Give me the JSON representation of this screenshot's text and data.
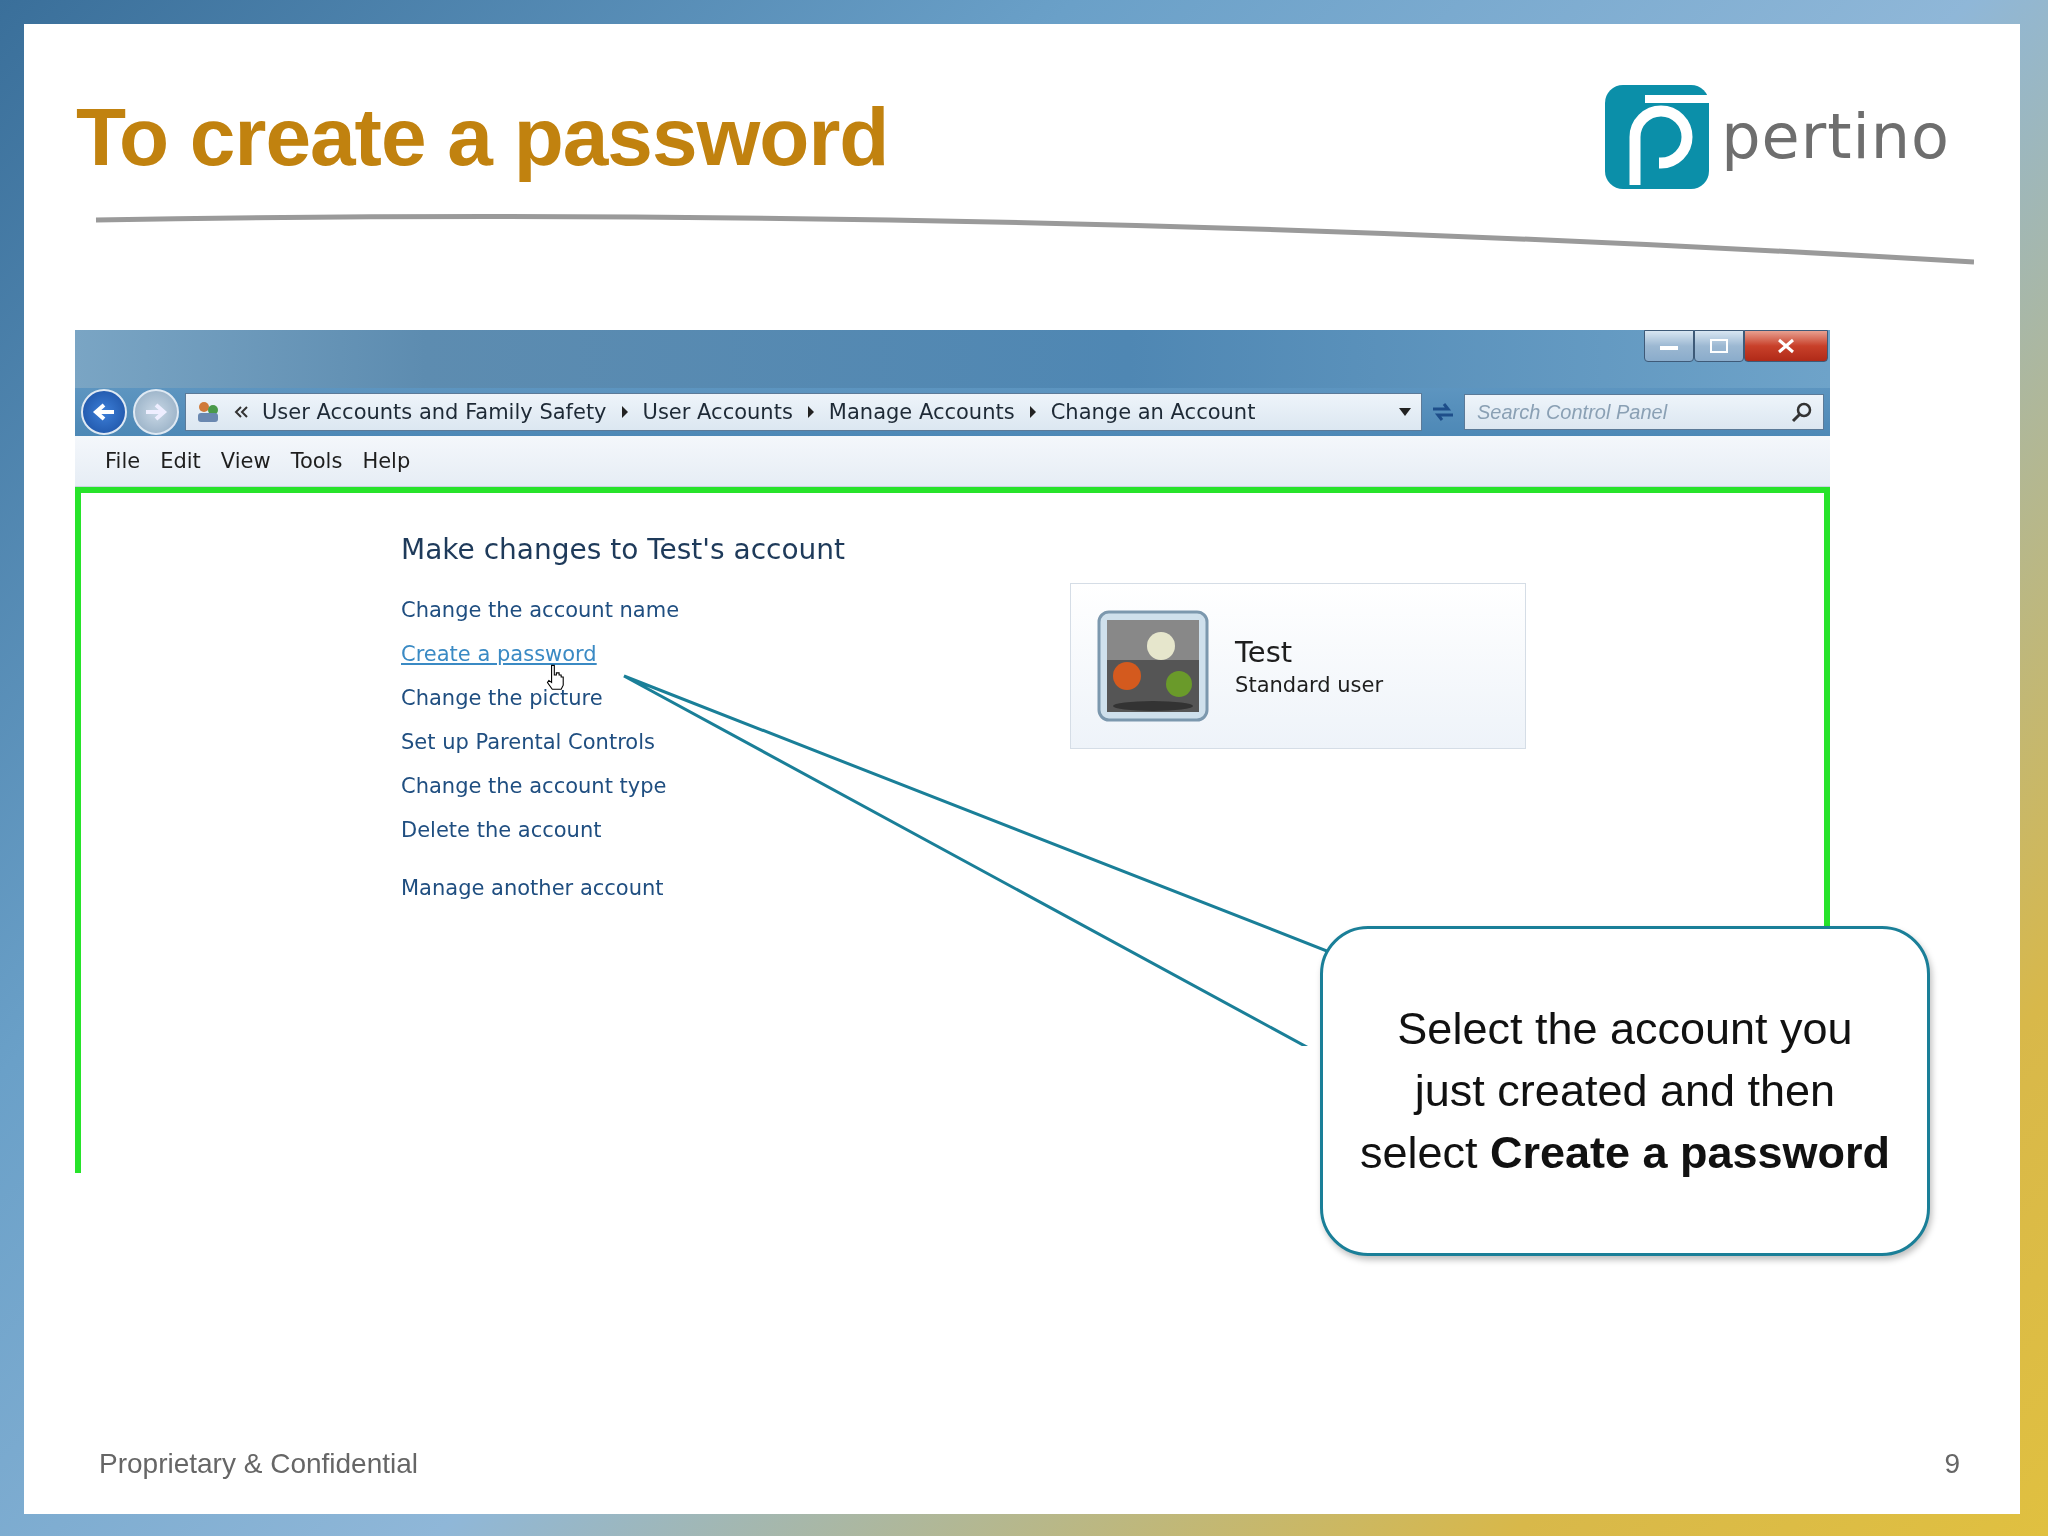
{
  "slide": {
    "title": "To create a password",
    "logo_text": "pertino"
  },
  "window": {
    "breadcrumb": [
      "User Accounts and Family Safety",
      "User Accounts",
      "Manage Accounts",
      "Change an Account"
    ],
    "search": {
      "placeholder": "Search Control Panel"
    },
    "menu": [
      "File",
      "Edit",
      "View",
      "Tools",
      "Help"
    ],
    "heading": "Make changes to Test's account",
    "tasks": [
      {
        "label": "Change the account name",
        "hovered": false
      },
      {
        "label": "Create a password",
        "hovered": true
      },
      {
        "label": "Change the picture",
        "hovered": false
      },
      {
        "label": "Set up Parental Controls",
        "hovered": false
      },
      {
        "label": "Change the account type",
        "hovered": false
      },
      {
        "label": "Delete the account",
        "hovered": false
      }
    ],
    "other_link": "Manage another account",
    "account": {
      "name": "Test",
      "type": "Standard user"
    }
  },
  "callout": {
    "lines": [
      "Select the account you",
      "just created and then",
      "select **Create a password**"
    ]
  },
  "footer": {
    "left": "Proprietary & Confidential",
    "page": "9"
  }
}
